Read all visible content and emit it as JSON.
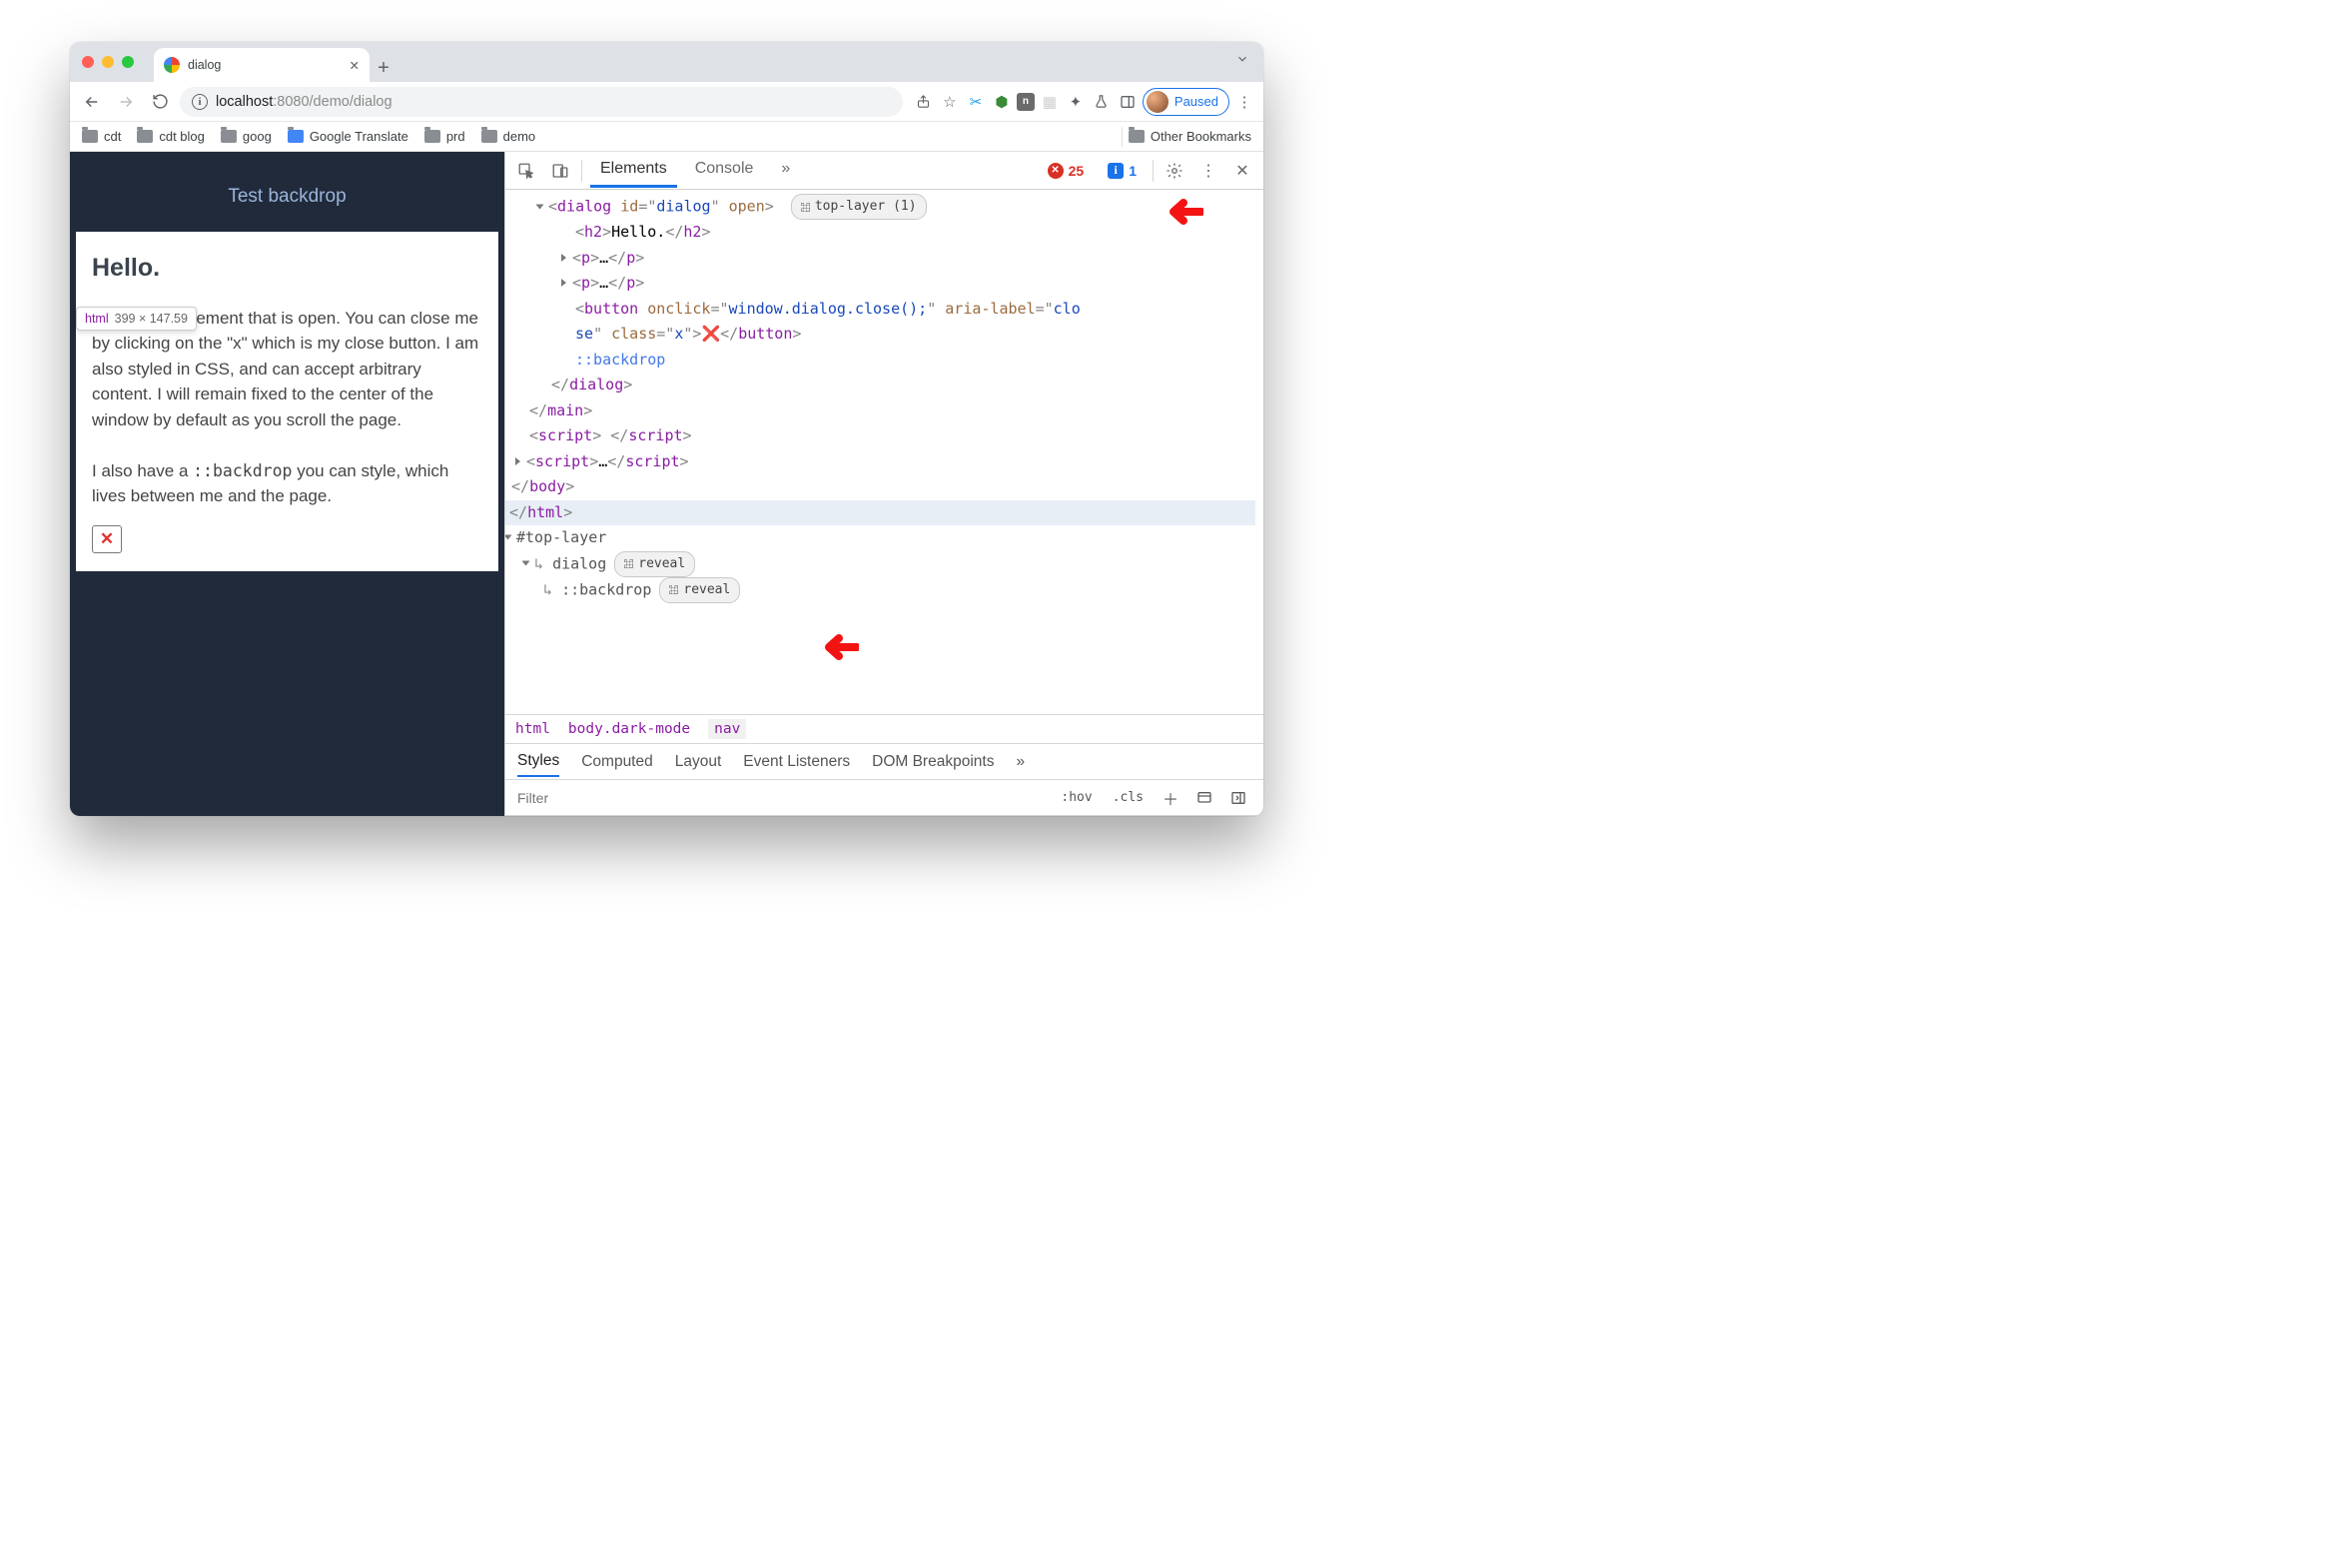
{
  "tab": {
    "title": "dialog"
  },
  "url": {
    "host": "localhost",
    "port": ":8080",
    "path": "/demo/dialog"
  },
  "profile": {
    "label": "Paused"
  },
  "bookmarks": [
    "cdt",
    "cdt blog",
    "goog",
    "Google Translate",
    "prd",
    "demo"
  ],
  "bookmarks_other": "Other Bookmarks",
  "page": {
    "backdrop_btn": "Test backdrop",
    "heading": "Hello.",
    "p1a": "I'm a dialog element that is open. You can close me by clicking on the \"x\" which is my close button. I am also styled in CSS, and can accept arbitrary content. I will remain fixed to the center of the window by default as you scroll the page.",
    "p2a": "I also have a ",
    "p2code": "::backdrop",
    "p2b": " you can style, which lives between me and the page.",
    "close_glyph": "✕",
    "tooltip_tag": "html",
    "tooltip_dim": "399 × 147.59"
  },
  "devtools": {
    "tabs": {
      "elements": "Elements",
      "console": "Console",
      "more": "»"
    },
    "errors": "25",
    "infos": "1",
    "breadcrumb": [
      "html",
      "body.dark-mode",
      "nav"
    ],
    "styles_tabs": [
      "Styles",
      "Computed",
      "Layout",
      "Event Listeners",
      "DOM Breakpoints",
      "»"
    ],
    "filter_placeholder": "Filter",
    "hov": ":hov",
    "cls": ".cls"
  },
  "tree": {
    "dialog_open": "<dialog id=\"dialog\" open>",
    "top_layer_badge": "top-layer (1)",
    "h2": {
      "open": "<h2>",
      "text": "Hello.",
      "close": "</h2>"
    },
    "p_collapsed": {
      "open": "<p>",
      "ell": "…",
      "close": "</p>"
    },
    "button_line1": "<button onclick=\"window.dialog.close();\" aria-label=\"clo",
    "button_line2": "se\" class=\"x\">",
    "button_glyph": "❌",
    "button_close": "</button>",
    "backdrop": "::backdrop",
    "dialog_close": "</dialog>",
    "main_close": "</main>",
    "script_empty": {
      "open": "<script> ",
      "close": "</script>"
    },
    "script_coll": {
      "open": "<script>",
      "ell": "…",
      "close": "</script>"
    },
    "body_close": "</body>",
    "html_close": "</html>",
    "top_layer_node": "#top-layer",
    "tl_dialog": "dialog",
    "tl_backdrop": "::backdrop",
    "reveal": "reveal"
  }
}
